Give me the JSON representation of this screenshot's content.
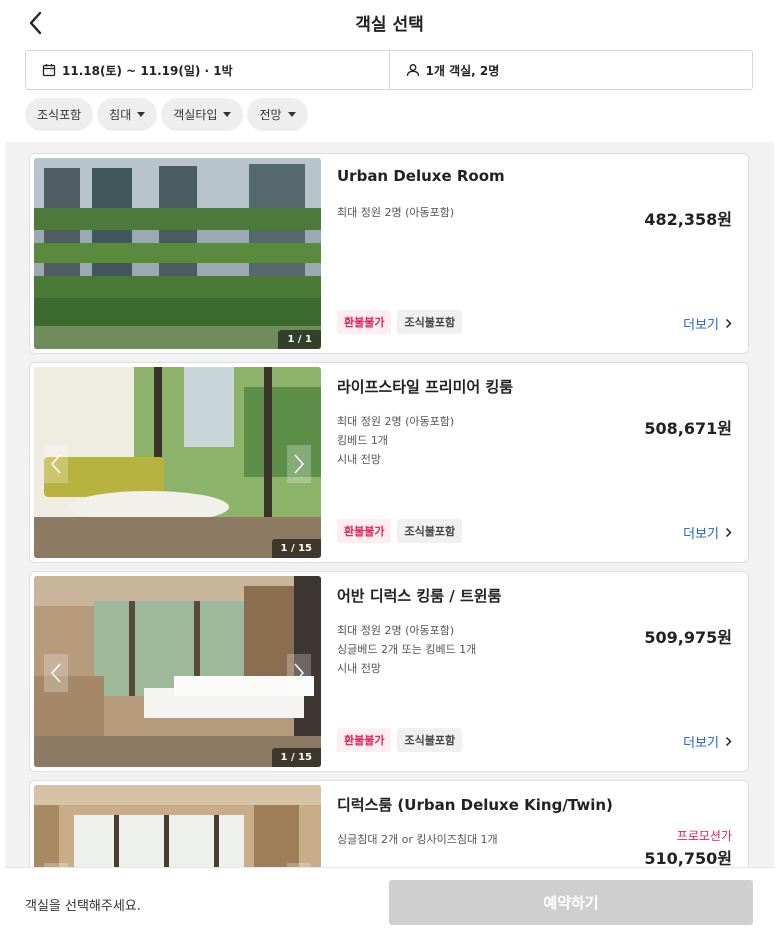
{
  "header": {
    "title": "객실 선택",
    "back_icon": "chevron-left-icon"
  },
  "search": {
    "dates": "11.18(토) ~ 11.19(일) · 1박",
    "guests": "1개 객실, 2명"
  },
  "filters": [
    {
      "label": "조식포함",
      "dropdown": false
    },
    {
      "label": "침대",
      "dropdown": true
    },
    {
      "label": "객실타입",
      "dropdown": true
    },
    {
      "label": "전망",
      "dropdown": true
    }
  ],
  "rooms": [
    {
      "name": "Urban Deluxe Room",
      "details": [
        "최대 정원 2명 (아동포함)"
      ],
      "price": "482,358원",
      "promo": "",
      "badges": [
        "환불불가",
        "조식불포함"
      ],
      "more": "더보기",
      "photo_count": "1 / 1"
    },
    {
      "name": "라이프스타일 프리미어 킹룸",
      "details": [
        "최대 정원 2명 (아동포함)",
        "킹베드 1개",
        "시내 전망"
      ],
      "price": "508,671원",
      "promo": "",
      "badges": [
        "환불불가",
        "조식불포함"
      ],
      "more": "더보기",
      "photo_count": "1 / 15"
    },
    {
      "name": "어반 디럭스 킹룸 / 트윈룸",
      "details": [
        "최대 정원 2명 (아동포함)",
        "싱글베드 2개 또는 킹베드 1개",
        "시내 전망"
      ],
      "price": "509,975원",
      "promo": "",
      "badges": [
        "환불불가",
        "조식불포함"
      ],
      "more": "더보기",
      "photo_count": "1 / 15"
    },
    {
      "name": "디럭스룸 (Urban Deluxe King/Twin)",
      "details": [
        "싱글침대 2개 or 킹사이즈침대 1개"
      ],
      "price": "510,750원",
      "promo": "프로모션가",
      "badges": [],
      "more": "",
      "photo_count": ""
    }
  ],
  "footer": {
    "message": "객실을 선택해주세요.",
    "reserve_label": "예약하기"
  },
  "colors": {
    "accent_red": "#e0245e",
    "link_blue": "#1f5fd6",
    "disabled_button": "#cfcfcf"
  }
}
